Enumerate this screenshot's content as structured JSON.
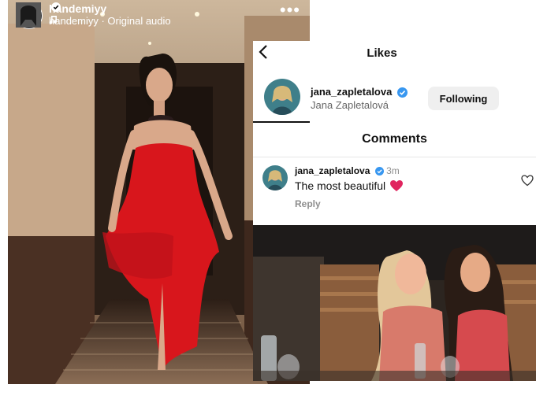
{
  "reel": {
    "username": "handemiyy",
    "audio_text": "handemiyy · Original audio"
  },
  "likes": {
    "title": "Likes",
    "user": {
      "username": "jana_zapletalova",
      "full_name": "Jana Zapletalová",
      "follow_label": "Following"
    }
  },
  "comments": {
    "title": "Comments",
    "items": [
      {
        "username": "jana_zapletalova",
        "time": "3m",
        "text": "The most beautiful",
        "reply_label": "Reply"
      }
    ]
  },
  "colors": {
    "verified": "#3897f0",
    "heart": "#e0245e",
    "dress": "#d8161c"
  }
}
